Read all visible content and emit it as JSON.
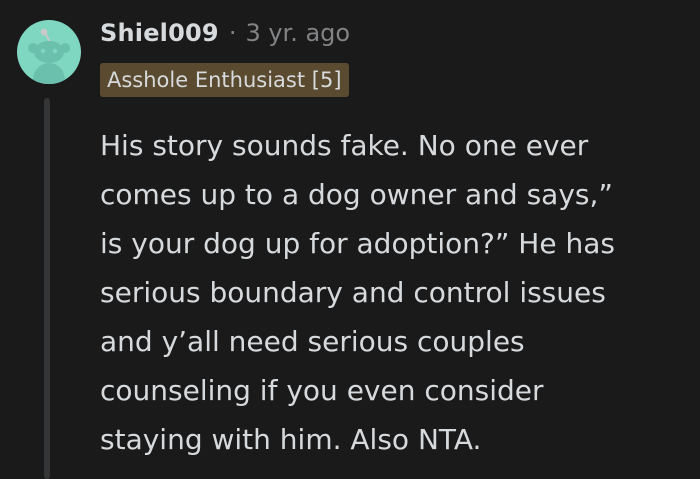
{
  "comment": {
    "username": "Shiel009",
    "separator": "·",
    "time_ago": "3 yr. ago",
    "flair": "Asshole Enthusiast [5]",
    "avatar_icon": "reddit-snoo-avatar-icon",
    "body_lines": [
      "His story sounds fake. No one ever",
      "comes up to a dog owner and says,”",
      "is your dog up for adoption?” He has",
      "serious boundary and control issues",
      "and y’all need serious couples",
      "counseling if you even consider",
      "staying with him. Also NTA."
    ]
  },
  "colors": {
    "background": "#1a1a1b",
    "text": "#d7dadc",
    "muted": "#818384",
    "flair_bg": "#5a4a2f",
    "avatar_bg": "#7fd6c1"
  }
}
